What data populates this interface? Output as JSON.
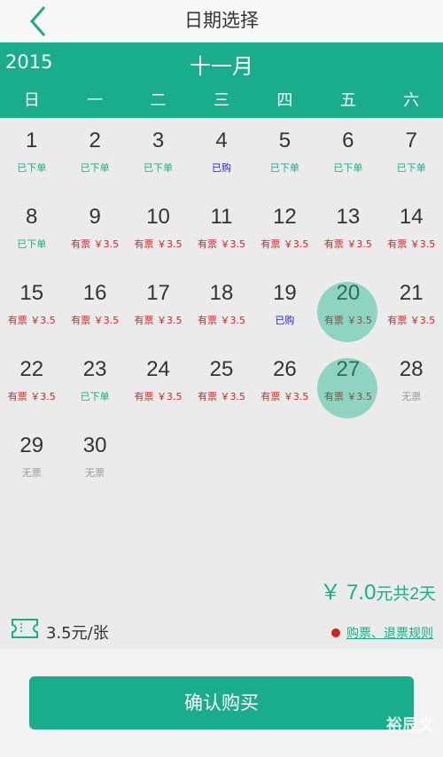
{
  "header": {
    "title": "日期选择"
  },
  "calendar": {
    "year": "2015",
    "month": "十一月",
    "weekdays": [
      "日",
      "一",
      "二",
      "三",
      "四",
      "五",
      "六"
    ],
    "days": [
      {
        "day": "1",
        "status": "已下单",
        "type": "ordered"
      },
      {
        "day": "2",
        "status": "已下单",
        "type": "ordered"
      },
      {
        "day": "3",
        "status": "已下单",
        "type": "ordered"
      },
      {
        "day": "4",
        "status": "已购",
        "type": "bought"
      },
      {
        "day": "5",
        "status": "已下单",
        "type": "ordered"
      },
      {
        "day": "6",
        "status": "已下单",
        "type": "ordered"
      },
      {
        "day": "7",
        "status": "已下单",
        "type": "ordered"
      },
      {
        "day": "8",
        "status": "已下单",
        "type": "ordered"
      },
      {
        "day": "9",
        "status": "有票 ￥3.5",
        "type": "avail"
      },
      {
        "day": "10",
        "status": "有票 ￥3.5",
        "type": "avail"
      },
      {
        "day": "11",
        "status": "有票 ￥3.5",
        "type": "avail"
      },
      {
        "day": "12",
        "status": "有票 ￥3.5",
        "type": "avail"
      },
      {
        "day": "13",
        "status": "有票 ￥3.5",
        "type": "avail"
      },
      {
        "day": "14",
        "status": "有票 ￥3.5",
        "type": "avail"
      },
      {
        "day": "15",
        "status": "有票 ￥3.5",
        "type": "avail"
      },
      {
        "day": "16",
        "status": "有票 ￥3.5",
        "type": "avail"
      },
      {
        "day": "17",
        "status": "有票 ￥3.5",
        "type": "avail"
      },
      {
        "day": "18",
        "status": "有票 ￥3.5",
        "type": "avail"
      },
      {
        "day": "19",
        "status": "已购",
        "type": "bought"
      },
      {
        "day": "20",
        "status": "有票 ￥3.5",
        "type": "avail",
        "selected": true
      },
      {
        "day": "21",
        "status": "有票 ￥3.5",
        "type": "avail"
      },
      {
        "day": "22",
        "status": "有票 ￥3.5",
        "type": "avail"
      },
      {
        "day": "23",
        "status": "已下单",
        "type": "ordered"
      },
      {
        "day": "24",
        "status": "有票 ￥3.5",
        "type": "avail"
      },
      {
        "day": "25",
        "status": "有票 ￥3.5",
        "type": "avail"
      },
      {
        "day": "26",
        "status": "有票 ￥3.5",
        "type": "avail"
      },
      {
        "day": "27",
        "status": "有票 ￥3.5",
        "type": "avail",
        "selected": true
      },
      {
        "day": "28",
        "status": "无票",
        "type": "none"
      },
      {
        "day": "29",
        "status": "无票",
        "type": "none"
      },
      {
        "day": "30",
        "status": "无票",
        "type": "none"
      }
    ]
  },
  "summary": {
    "currency": "￥",
    "amount": "7.0",
    "desc": "元共2天"
  },
  "ticket": {
    "price": "3.5元/张",
    "rules_link": "购票、退票规则"
  },
  "footer": {
    "confirm_label": "确认购买",
    "watermark": "裕辰文"
  },
  "colors": {
    "accent": "#19ad8c",
    "selected": "#8fd4c2",
    "available": "#e02020",
    "bought": "#2222cc"
  }
}
